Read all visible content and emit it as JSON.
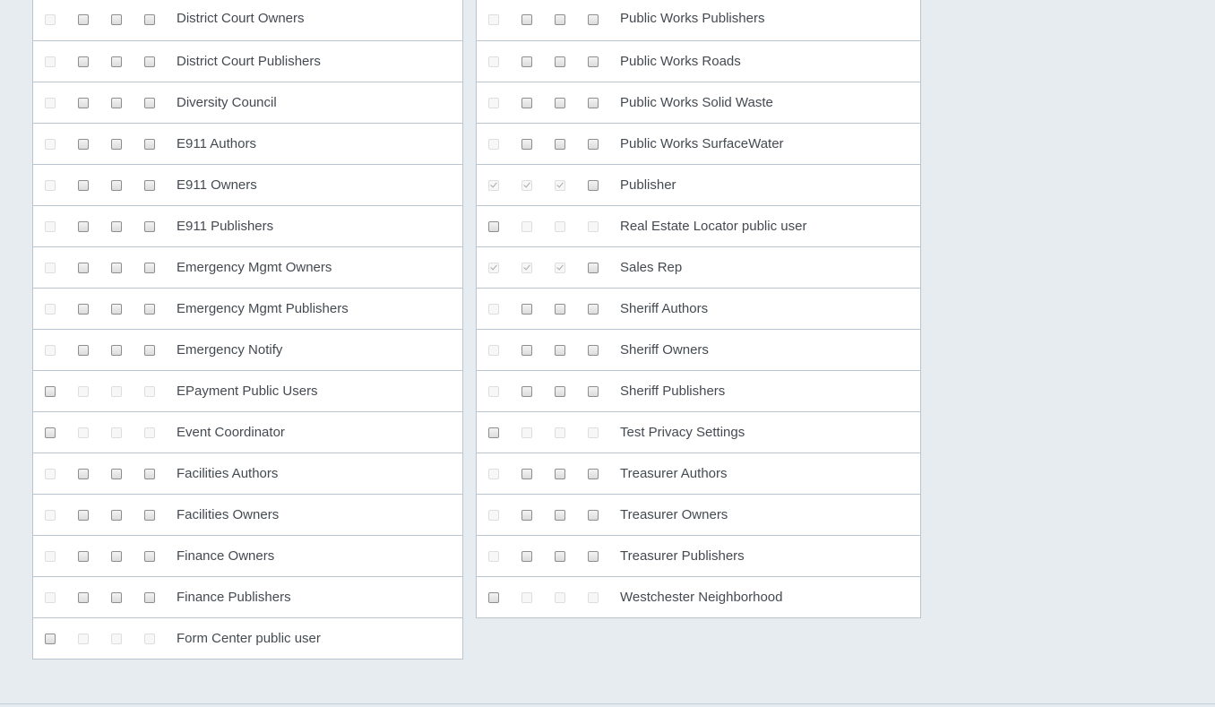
{
  "left_table": {
    "rows": [
      {
        "label": "District Court Owners",
        "checks": [
          false,
          false,
          false,
          false
        ],
        "disabled": [
          true,
          false,
          false,
          false
        ]
      },
      {
        "label": "District Court Publishers",
        "checks": [
          false,
          false,
          false,
          false
        ],
        "disabled": [
          true,
          false,
          false,
          false
        ]
      },
      {
        "label": "Diversity Council",
        "checks": [
          false,
          false,
          false,
          false
        ],
        "disabled": [
          true,
          false,
          false,
          false
        ]
      },
      {
        "label": "E911 Authors",
        "checks": [
          false,
          false,
          false,
          false
        ],
        "disabled": [
          true,
          false,
          false,
          false
        ]
      },
      {
        "label": "E911 Owners",
        "checks": [
          false,
          false,
          false,
          false
        ],
        "disabled": [
          true,
          false,
          false,
          false
        ]
      },
      {
        "label": "E911 Publishers",
        "checks": [
          false,
          false,
          false,
          false
        ],
        "disabled": [
          true,
          false,
          false,
          false
        ]
      },
      {
        "label": "Emergency Mgmt Owners",
        "checks": [
          false,
          false,
          false,
          false
        ],
        "disabled": [
          true,
          false,
          false,
          false
        ]
      },
      {
        "label": "Emergency Mgmt Publishers",
        "checks": [
          false,
          false,
          false,
          false
        ],
        "disabled": [
          true,
          false,
          false,
          false
        ]
      },
      {
        "label": "Emergency Notify",
        "checks": [
          false,
          false,
          false,
          false
        ],
        "disabled": [
          true,
          false,
          false,
          false
        ]
      },
      {
        "label": "EPayment Public Users",
        "checks": [
          false,
          false,
          false,
          false
        ],
        "disabled": [
          false,
          true,
          true,
          true
        ]
      },
      {
        "label": "Event Coordinator",
        "checks": [
          false,
          false,
          false,
          false
        ],
        "disabled": [
          false,
          true,
          true,
          true
        ]
      },
      {
        "label": "Facilities Authors",
        "checks": [
          false,
          false,
          false,
          false
        ],
        "disabled": [
          true,
          false,
          false,
          false
        ]
      },
      {
        "label": "Facilities Owners",
        "checks": [
          false,
          false,
          false,
          false
        ],
        "disabled": [
          true,
          false,
          false,
          false
        ]
      },
      {
        "label": "Finance Owners",
        "checks": [
          false,
          false,
          false,
          false
        ],
        "disabled": [
          true,
          false,
          false,
          false
        ]
      },
      {
        "label": "Finance Publishers",
        "checks": [
          false,
          false,
          false,
          false
        ],
        "disabled": [
          true,
          false,
          false,
          false
        ]
      },
      {
        "label": "Form Center public user",
        "checks": [
          false,
          false,
          false,
          false
        ],
        "disabled": [
          false,
          true,
          true,
          true
        ]
      }
    ]
  },
  "right_table": {
    "rows": [
      {
        "label": "Public Works Publishers",
        "checks": [
          false,
          false,
          false,
          false
        ],
        "disabled": [
          true,
          false,
          false,
          false
        ]
      },
      {
        "label": "Public Works Roads",
        "checks": [
          false,
          false,
          false,
          false
        ],
        "disabled": [
          true,
          false,
          false,
          false
        ]
      },
      {
        "label": "Public Works Solid Waste",
        "checks": [
          false,
          false,
          false,
          false
        ],
        "disabled": [
          true,
          false,
          false,
          false
        ]
      },
      {
        "label": "Public Works SurfaceWater",
        "checks": [
          false,
          false,
          false,
          false
        ],
        "disabled": [
          true,
          false,
          false,
          false
        ]
      },
      {
        "label": "Publisher",
        "checks": [
          true,
          true,
          true,
          false
        ],
        "disabled": [
          true,
          true,
          true,
          false
        ]
      },
      {
        "label": "Real Estate Locator public user",
        "checks": [
          false,
          false,
          false,
          false
        ],
        "disabled": [
          false,
          true,
          true,
          true
        ]
      },
      {
        "label": "Sales Rep",
        "checks": [
          true,
          true,
          true,
          false
        ],
        "disabled": [
          true,
          true,
          true,
          false
        ]
      },
      {
        "label": "Sheriff Authors",
        "checks": [
          false,
          false,
          false,
          false
        ],
        "disabled": [
          true,
          false,
          false,
          false
        ]
      },
      {
        "label": "Sheriff Owners",
        "checks": [
          false,
          false,
          false,
          false
        ],
        "disabled": [
          true,
          false,
          false,
          false
        ]
      },
      {
        "label": "Sheriff Publishers",
        "checks": [
          false,
          false,
          false,
          false
        ],
        "disabled": [
          true,
          false,
          false,
          false
        ]
      },
      {
        "label": "Test Privacy Settings",
        "checks": [
          false,
          false,
          false,
          false
        ],
        "disabled": [
          false,
          true,
          true,
          true
        ]
      },
      {
        "label": "Treasurer Authors",
        "checks": [
          false,
          false,
          false,
          false
        ],
        "disabled": [
          true,
          false,
          false,
          false
        ]
      },
      {
        "label": "Treasurer Owners",
        "checks": [
          false,
          false,
          false,
          false
        ],
        "disabled": [
          true,
          false,
          false,
          false
        ]
      },
      {
        "label": "Treasurer Publishers",
        "checks": [
          false,
          false,
          false,
          false
        ],
        "disabled": [
          true,
          false,
          false,
          false
        ]
      },
      {
        "label": "Westchester Neighborhood",
        "checks": [
          false,
          false,
          false,
          false
        ],
        "disabled": [
          false,
          true,
          true,
          true
        ]
      }
    ]
  }
}
